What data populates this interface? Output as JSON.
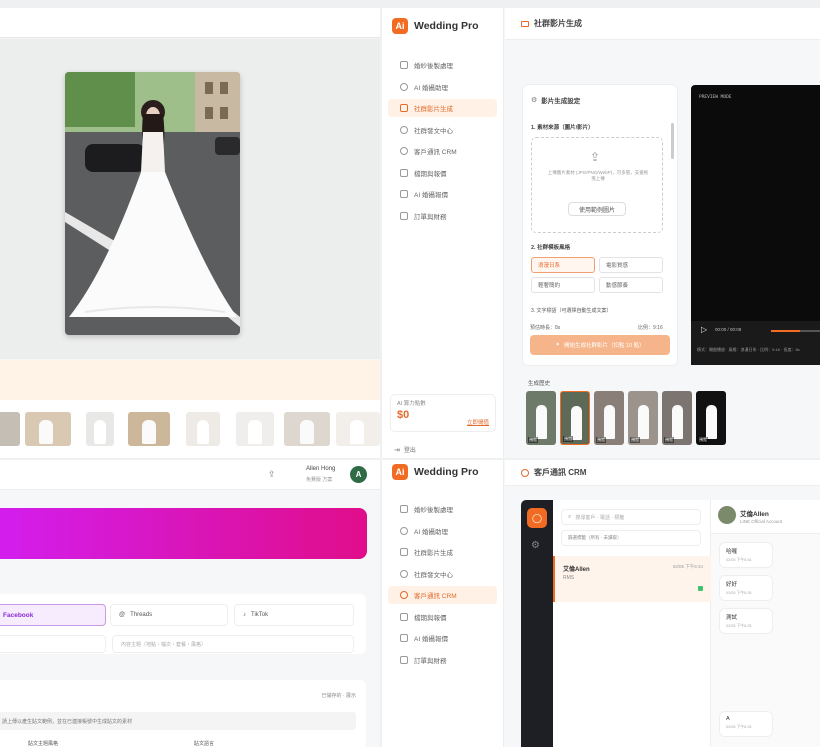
{
  "app": {
    "name": "Wedding Pro",
    "logo_letter": "Ai"
  },
  "sidebar_top": {
    "items": [
      {
        "label": "婚紗後製處理",
        "icon": "image-icon"
      },
      {
        "label": "AI 婚攝助理",
        "icon": "shield-icon"
      },
      {
        "label": "社群影片生成",
        "icon": "video-icon",
        "active": true
      },
      {
        "label": "社群發文中心",
        "icon": "share-icon"
      },
      {
        "label": "客戶通訊 CRM",
        "icon": "chat-icon"
      },
      {
        "label": "檔期與報價",
        "icon": "calendar-icon"
      },
      {
        "label": "AI 婚攝報價",
        "icon": "list-icon"
      },
      {
        "label": "訂單與財務",
        "icon": "wallet-icon"
      }
    ],
    "points_label": "AI 算力點數",
    "points_value": "$0",
    "points_link": "立即儲值",
    "logout_label": "登出"
  },
  "sidebar_bottom": {
    "items": [
      {
        "label": "婚紗後製處理",
        "icon": "image-icon"
      },
      {
        "label": "AI 婚攝助理",
        "icon": "shield-icon"
      },
      {
        "label": "社群影片生成",
        "icon": "video-icon"
      },
      {
        "label": "社群發文中心",
        "icon": "share-icon"
      },
      {
        "label": "客戶通訊 CRM",
        "icon": "chat-icon",
        "active": true
      },
      {
        "label": "檔期與報價",
        "icon": "calendar-icon"
      },
      {
        "label": "AI 婚攝報價",
        "icon": "list-icon"
      },
      {
        "label": "訂單與財務",
        "icon": "wallet-icon"
      }
    ]
  },
  "video_panel": {
    "header_title": "社群影片生成",
    "settings_title": "影片生成設定",
    "step1_label": "1. 素材來源（圖片/影片）",
    "upload_hint": "上傳圖片素材 (JPG/PNG/WebP)，可多張，支援拖曳上傳",
    "upload_button": "使用範例圖片",
    "step2_label": "2. 社群模板風格",
    "styles": [
      "浪漫日系",
      "電影質感",
      "輕奢簡約",
      "動感節奏"
    ],
    "step3_label": "3. 文字標語（可選擇自動生成文案）",
    "footer_left": "預估時長：8s",
    "footer_right": "比例：9:16",
    "generate_button": "開始生成社群影片（扣點 10 點）",
    "preview_label": "PREVIEW MODE",
    "player_time": "00:00 / 00:08",
    "player_info": "模式：開啟播放 · 風格：浪漫日系 · 比例：9:16 · 長度：8s",
    "history_label": "生成歷史",
    "history_badge": "預覽"
  },
  "crm_panel": {
    "header_title": "客戶通訊 CRM",
    "search_placeholder": "搜尋客戶 · 電話 · 標籤",
    "filter_label": "篩選標籤（所有 · 未讀取）",
    "chat_name": "艾倫Allen",
    "chat_preview": "RMS",
    "chat_time": "02/05 下午6:34",
    "contact_name": "艾倫Allen",
    "contact_sub": "LINE Official Account",
    "messages": [
      {
        "title": "哈囉",
        "time": "02/05 下午6:34"
      },
      {
        "title": "好好",
        "time": "02/05 下午6:35"
      },
      {
        "title": "測試",
        "time": "02/05 下午6:33"
      },
      {
        "title": "A",
        "time": "02/05 下午6:33"
      }
    ]
  },
  "social_panel": {
    "user_name": "Allen Hong",
    "user_plan": "免費版 方案",
    "avatar_letter": "A",
    "platform_active": "Facebook",
    "platform_threads": "Threads",
    "platform_tiktok": "TikTok",
    "topic_placeholder": "內容主題（地點・檔次・套餐・風格）",
    "section_right": "已儲存的 · 展示",
    "note_text": "請上傳以產生貼文範例，並在已連接帳號中生成貼文的素材",
    "col_a": "貼文主題風格",
    "col_b": "貼文語言"
  },
  "colors": {
    "accent": "#f26b22",
    "gradient_start": "#d21ef0",
    "gradient_end": "#e00e8a",
    "dark": "#0b0b0b"
  }
}
